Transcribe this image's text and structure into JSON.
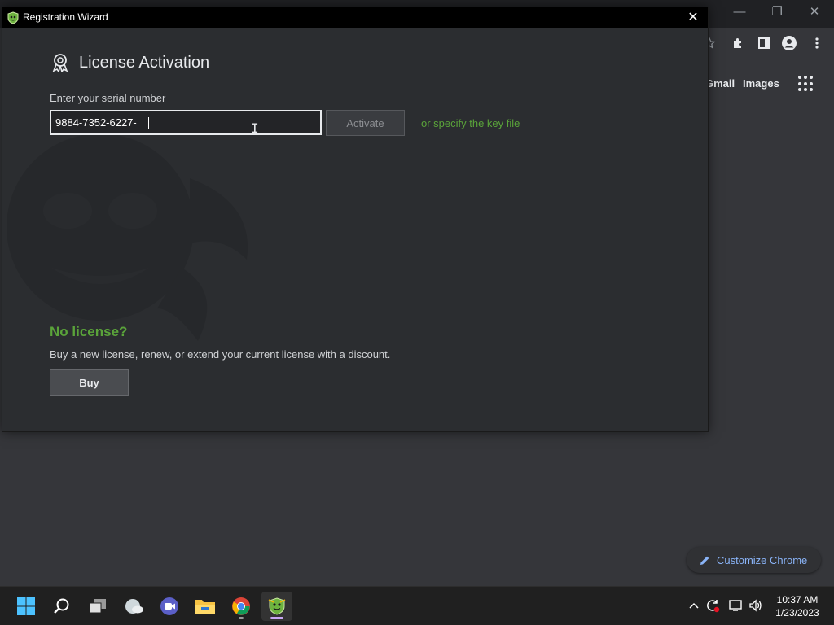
{
  "dialog": {
    "title": "Registration Wizard",
    "close_symbol": "✕",
    "heading": "License Activation",
    "serial_label": "Enter your serial number",
    "serial_value": "9884-7352-6227-",
    "activate_label": "Activate",
    "keyfile_link": "or specify the key file",
    "no_license_heading": "No license?",
    "buy_text": "Buy a new license, renew, or extend your current license with a discount.",
    "buy_label": "Buy"
  },
  "chrome": {
    "gmail_label": "Gmail",
    "images_label": "Images",
    "customize_label": "Customize Chrome",
    "window_controls": {
      "minimize": "—",
      "restore": "❐",
      "close": "✕"
    }
  },
  "taskbar": {
    "apps": [
      "start-icon",
      "search-icon",
      "task-view-icon",
      "widgets-icon",
      "teams-icon",
      "file-explorer-icon",
      "chrome-icon",
      "antivirus-icon"
    ],
    "time": "10:37 AM",
    "date": "1/23/2023"
  },
  "colors": {
    "accent_green": "#5aa33a",
    "dialog_bg": "#2b2d30",
    "chrome_bg": "#35363a",
    "link_blue": "#8ab4f8"
  }
}
